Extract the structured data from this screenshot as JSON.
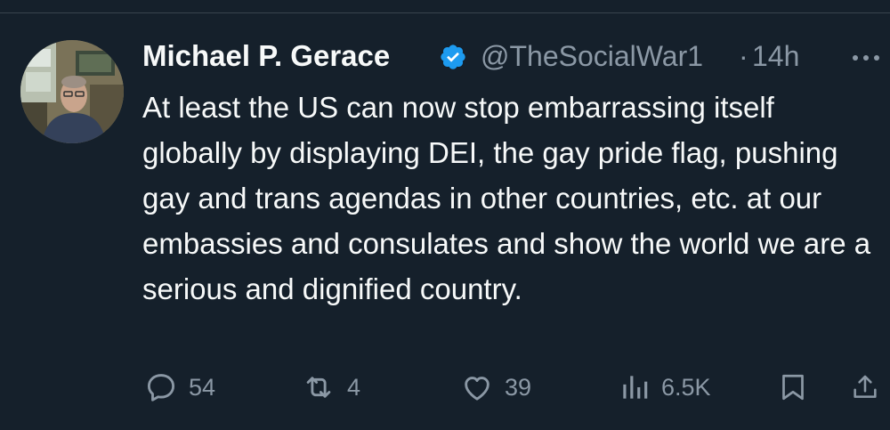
{
  "tweet": {
    "author": {
      "display_name": "Michael P. Gerace",
      "handle": "@TheSocialWar1",
      "verified": true,
      "avatar_icon": "profile-photo"
    },
    "separator": "·",
    "timestamp": "14h",
    "more_icon": "more-horizontal-icon",
    "text": "At least the US can now stop embarrassing itself globally by displaying DEI, the gay pride flag, pushing gay and trans agendas in other countries, etc. at our embassies and consulates and show the world we are a serious and dignified country.",
    "actions": {
      "replies": "54",
      "retweets": "4",
      "likes": "39",
      "views": "6.5K"
    }
  },
  "colors": {
    "background": "#15202b",
    "primary_text": "#f7f9f9",
    "secondary_text": "#8b98a5",
    "verified_badge": "#1d9bf0",
    "divider": "#38444d"
  }
}
